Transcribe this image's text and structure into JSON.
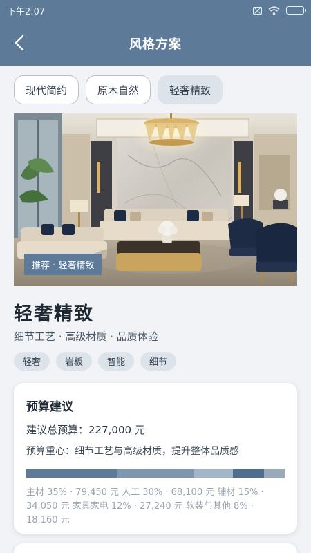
{
  "status_bar": {
    "time": "下午2:07",
    "icons": [
      "sim-off-icon",
      "wifi-icon",
      "battery-charging-icon"
    ]
  },
  "header": {
    "title": "风格方案",
    "back_icon": "chevron-left-icon"
  },
  "tabs": [
    {
      "label": "现代简约",
      "active": false
    },
    {
      "label": "原木自然",
      "active": false
    },
    {
      "label": "轻奢精致",
      "active": true
    }
  ],
  "hero": {
    "badge": "推荐 · 轻奢精致"
  },
  "style": {
    "name": "轻奢精致",
    "description": "细节工艺 · 高级材质 · 品质体验",
    "tags": [
      "轻奢",
      "岩板",
      "智能",
      "细节"
    ]
  },
  "budget": {
    "title": "预算建议",
    "total": "建议总预算：227,000 元",
    "focus": "预算重心：细节工艺与高级材质，提升整体品质感",
    "breakdown": [
      {
        "label": "主材",
        "percent": 35,
        "amount": "79,450 元",
        "color": "#5d7a99"
      },
      {
        "label": "人工",
        "percent": 30,
        "amount": "68,100 元",
        "color": "#7e97b1"
      },
      {
        "label": "辅材",
        "percent": 15,
        "amount": "34,050 元",
        "color": "#a3b6c9"
      },
      {
        "label": "家具家电",
        "percent": 12,
        "amount": "27,240 元",
        "color": "#4f6d8c"
      },
      {
        "label": "软装与其他",
        "percent": 8,
        "amount": "18,160 元",
        "color": "#9aaabb"
      }
    ],
    "legend": "主材 35% · 79,450 元 人工 30% · 68,100 元 辅材 15% · 34,050 元 家具家电 12% · 27,240 元 软装与其他 8% · 18,160 元"
  }
}
